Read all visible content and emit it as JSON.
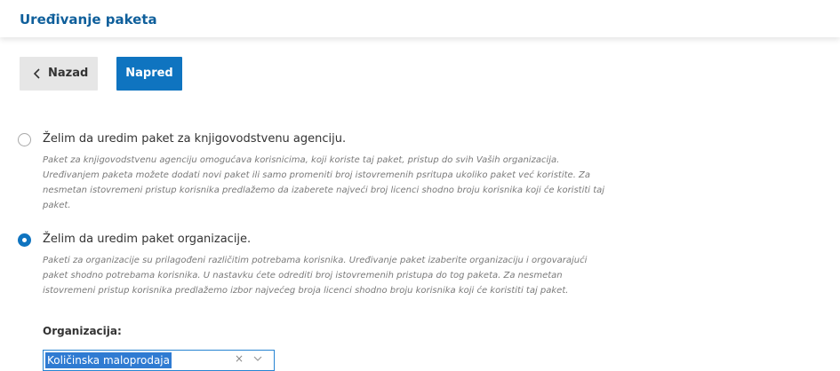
{
  "header": {
    "title": "Uređivanje paketa"
  },
  "toolbar": {
    "back_label": "Nazad",
    "next_label": "Napred",
    "accent": "#0f74c0"
  },
  "options": [
    {
      "label": "Želim da uredim paket za knjigovodstvenu agenciju.",
      "selected": false,
      "description_lines": [
        "Paket za knjigovodstvenu agenciju omogućava korisnicima, koji koriste taj paket, pristup do svih Vaših organizacija.",
        "Uređivanjem paketa možete dodati novi paket ili samo promeniti broj istovremenih psritupa ukoliko paket već koristite. Za",
        "nesmetan istovremeni pristup korisnika predlažemo da izaberete najveći broj licenci shodno broju korisnika koji će koristiti taj",
        "paket."
      ]
    },
    {
      "label": "Želim da uredim paket organizacije.",
      "selected": true,
      "description_lines": [
        "Paketi za organizacije su prilagođeni različitim potrebama korisnika. Uređivanje paket izaberite organizaciju i orgovarajući",
        "paket shodno potrebama korisnika. U nastavku ćete odrediti broj istovremenih pristupa do tog paketa. Za nesmetan",
        "istovremeni pristup korisnika predlažemo izbor najvećeg broja licenci shodno broju korisnika koji će koristiti taj paket."
      ]
    }
  ],
  "organization": {
    "label": "Organizacija:",
    "value": "Količinska maloprodaja",
    "clear_icon": "×"
  }
}
